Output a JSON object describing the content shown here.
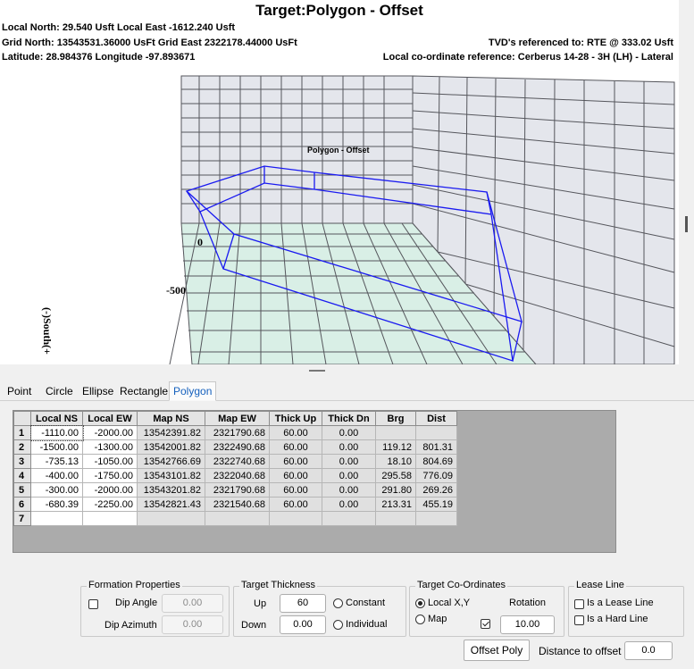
{
  "view": {
    "title": "Target:Polygon - Offset",
    "local_north_east": "Local North: 29.540 Usft Local East -1612.240 Usft",
    "grid_north_east": "Grid North: 13543531.36000 UsFt Grid East 2322178.44000 UsFt",
    "lat_long": "Latitude: 28.984376 Longitude -97.893671",
    "tvd_reference": "TVD's referenced to: RTE @ 333.02 Usft",
    "local_coord_reference": "Local co-ordinate reference: Cerberus 14-28 - 3H (LH) - Lateral",
    "polygon_label": "Polygon - Offset",
    "axis_tick_0": "0",
    "axis_tick_neg500": "-500",
    "axis_label": "(-)South(+",
    "colors": {
      "floor": "#d9efe6",
      "walls": "#e4e6ec",
      "grid": "#55565c",
      "polygon": "#1a1af0"
    }
  },
  "tabs": [
    {
      "label": "Point",
      "active": false
    },
    {
      "label": "Circle",
      "active": false
    },
    {
      "label": "Ellipse",
      "active": false
    },
    {
      "label": "Rectangle",
      "active": false
    },
    {
      "label": "Polygon",
      "active": true
    }
  ],
  "grid": {
    "headers": [
      "Local NS",
      "Local EW",
      "Map NS",
      "Map EW",
      "Thick Up",
      "Thick Dn",
      "Brg",
      "Dist"
    ],
    "rows": [
      {
        "num": "1",
        "cells": [
          "-1110.00",
          "-2000.00",
          "13542391.82",
          "2321790.68",
          "60.00",
          "0.00",
          "",
          ""
        ]
      },
      {
        "num": "2",
        "cells": [
          "-1500.00",
          "-1300.00",
          "13542001.82",
          "2322490.68",
          "60.00",
          "0.00",
          "119.12",
          "801.31"
        ]
      },
      {
        "num": "3",
        "cells": [
          "-735.13",
          "-1050.00",
          "13542766.69",
          "2322740.68",
          "60.00",
          "0.00",
          "18.10",
          "804.69"
        ]
      },
      {
        "num": "4",
        "cells": [
          "-400.00",
          "-1750.00",
          "13543101.82",
          "2322040.68",
          "60.00",
          "0.00",
          "295.58",
          "776.09"
        ]
      },
      {
        "num": "5",
        "cells": [
          "-300.00",
          "-2000.00",
          "13543201.82",
          "2321790.68",
          "60.00",
          "0.00",
          "291.80",
          "269.26"
        ]
      },
      {
        "num": "6",
        "cells": [
          "-680.39",
          "-2250.00",
          "13542821.43",
          "2321540.68",
          "60.00",
          "0.00",
          "213.31",
          "455.19"
        ]
      },
      {
        "num": "7",
        "cells": [
          "",
          "",
          "",
          "",
          "",
          "",
          "",
          ""
        ]
      }
    ]
  },
  "formation": {
    "title": "Formation Properties",
    "dip_angle_label": "Dip Angle",
    "dip_angle_value": "0.00",
    "dip_azimuth_label": "Dip Azimuth",
    "dip_azimuth_value": "0.00"
  },
  "thickness": {
    "title": "Target Thickness",
    "up_label": "Up",
    "up_value": "60",
    "down_label": "Down",
    "down_value": "0.00",
    "constant_label": "Constant",
    "individual_label": "Individual"
  },
  "coords": {
    "title": "Target Co-Ordinates",
    "local_label": "Local X,Y",
    "map_label": "Map",
    "rotation_label": "Rotation",
    "rotation_value": "10.00"
  },
  "lease": {
    "title": "Lease Line",
    "is_lease_label": "Is a Lease Line",
    "is_hard_label": "Is a Hard Line"
  },
  "footer": {
    "offset_button": "Offset Poly",
    "distance_label": "Distance to offset",
    "distance_value": "0.0"
  }
}
